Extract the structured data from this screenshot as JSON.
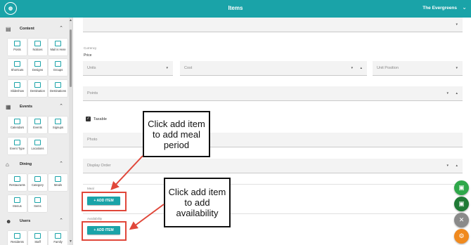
{
  "topbar": {
    "title": "Items",
    "community": "The Evergreens"
  },
  "sidebar": {
    "sections": [
      {
        "label": "Content",
        "icon": "content-icon",
        "tiles": [
          "Posts",
          "Notices",
          "Mail is Here",
          "Shortcuts",
          "Designs",
          "Groups",
          "Slideshow",
          "Destination",
          "Destinations"
        ]
      },
      {
        "label": "Events",
        "icon": "calendar-icon",
        "tiles": [
          "Calendars",
          "Events",
          "Signups",
          "Event Type",
          "Locations"
        ]
      },
      {
        "label": "Dining",
        "icon": "dining-icon",
        "tiles": [
          "Restaurants",
          "Category",
          "Meals",
          "Menus",
          "Items"
        ]
      },
      {
        "label": "Users",
        "icon": "user-icon",
        "tiles": [
          "Residents",
          "Staff",
          "Family"
        ]
      }
    ]
  },
  "form": {
    "currency_label": "Currency",
    "price_label": "Price",
    "units_placeholder": "Units",
    "cost_placeholder": "Cost",
    "unit_position_placeholder": "Unit Position",
    "points_placeholder": "Points",
    "taxable_label": "Taxable",
    "photo_placeholder": "Photo",
    "display_order_placeholder": "Display Order",
    "meal_label": "Meal",
    "availability_label": "Availability",
    "add_item_meal": "+ ADD ITEM",
    "add_item_availability": "+ ADD ITEM"
  },
  "callouts": {
    "meal": "Click add item to add meal period",
    "availability": "Click add item to add availability"
  },
  "fabs": [
    {
      "name": "save-icon",
      "color": "#2ea84a"
    },
    {
      "name": "save-copy-icon",
      "color": "#1f7a35"
    },
    {
      "name": "pin-icon",
      "color": "#8a8a8a"
    },
    {
      "name": "gear-icon",
      "color": "#f08a1f"
    }
  ],
  "colors": {
    "accent": "#1aa3a8",
    "highlight": "#e0473a"
  }
}
